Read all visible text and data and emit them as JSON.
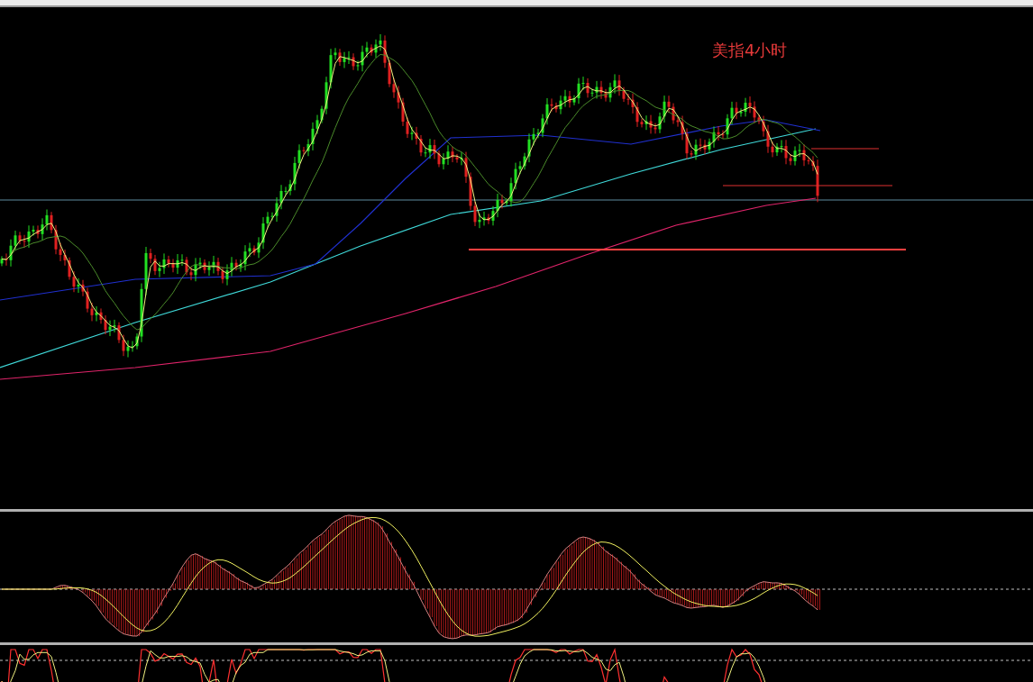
{
  "chart": {
    "title": "美指4小时"
  }
}
